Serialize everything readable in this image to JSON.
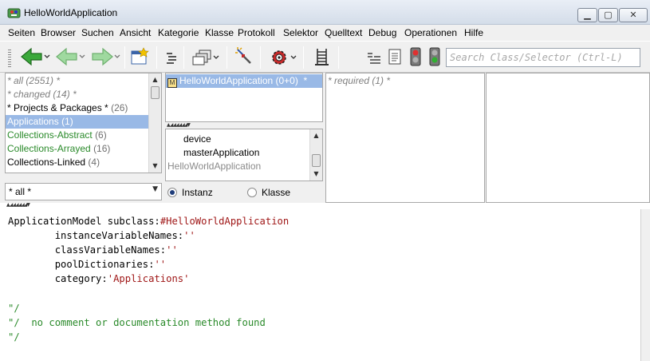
{
  "window": {
    "title": "HelloWorldApplication"
  },
  "menu": [
    "Seiten",
    "Browser",
    "Suchen",
    "Ansicht",
    "Kategorie",
    "Klasse",
    "Protokoll",
    "Selektor",
    "Quelltext",
    "Debug",
    "Operationen",
    "Hilfe"
  ],
  "search": {
    "placeholder": "Search Class/Selector (Ctrl-L)"
  },
  "categories": [
    {
      "label": "* all",
      "count": "(2551) *",
      "style": "gray"
    },
    {
      "label": "* changed",
      "count": "(14) *",
      "style": "gray"
    },
    {
      "label": "* Projects & Packages *",
      "count": "(26)",
      "style": "normal"
    },
    {
      "label": "Applications",
      "count": "(1)",
      "style": "selected"
    },
    {
      "label": "Collections-Abstract",
      "count": "(6)",
      "style": "green"
    },
    {
      "label": "Collections-Arrayed",
      "count": "(16)",
      "style": "green"
    },
    {
      "label": "Collections-Linked",
      "count": "(4)",
      "style": "normal"
    }
  ],
  "category_filter": "* all *",
  "classes": [
    {
      "label": "HelloWorldApplication (0+0)",
      "suffix": "*"
    }
  ],
  "variables": {
    "items": [
      "device",
      "masterApplication"
    ],
    "class_label": "HelloWorldApplication"
  },
  "instance_radio": {
    "instanz": "Instanz",
    "klasse": "Klasse",
    "selected": "Instanz"
  },
  "protocols": [
    {
      "label": "* required",
      "count": "(1) *"
    }
  ],
  "code": {
    "line1_a": "ApplicationModel subclass:",
    "line1_b": "#HelloWorldApplication",
    "line2_a": "        instanceVariableNames:",
    "line2_b": "''",
    "line3_a": "        classVariableNames:",
    "line3_b": "''",
    "line4_a": "        poolDictionaries:",
    "line4_b": "''",
    "line5_a": "        category:",
    "line5_b": "'Applications'",
    "comment1": "\"/",
    "comment2": "\"/  no comment or documentation method found",
    "comment3": "\"/"
  },
  "colors": {
    "selection": "#99b9e6",
    "green": "#2a8a2a",
    "string": "#a01818"
  }
}
